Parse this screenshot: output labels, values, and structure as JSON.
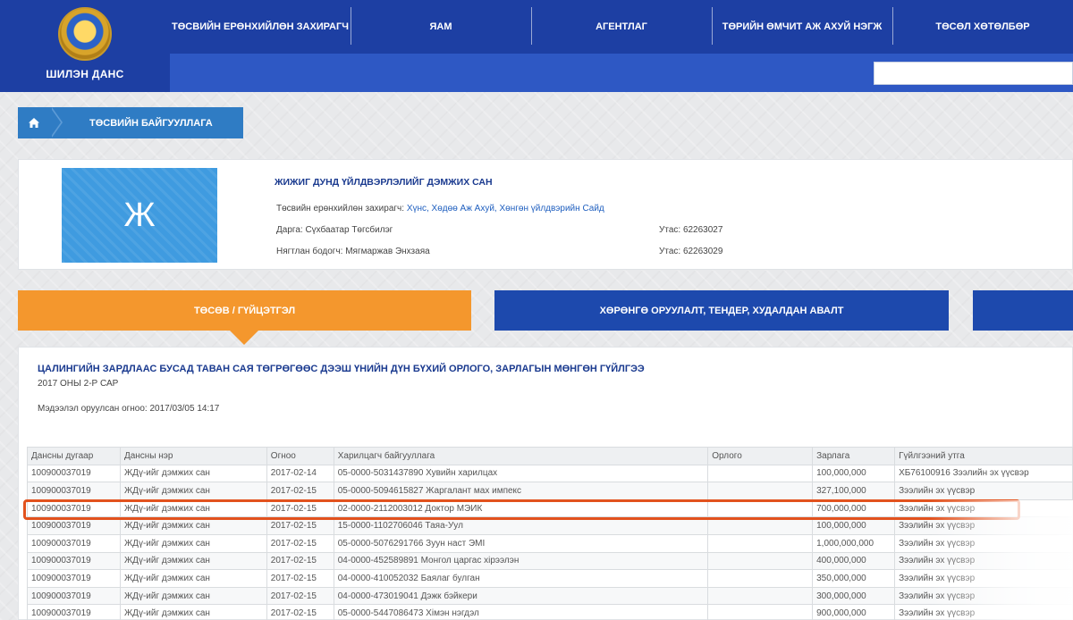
{
  "header": {
    "logo_text": "ШИЛЭН ДАНС",
    "nav": [
      "ТӨСВИЙН ЕРӨНХИЙЛӨН ЗАХИРАГЧ",
      "ЯАМ",
      "АГЕНТЛАГ",
      "ТӨРИЙН ӨМЧИТ АЖ АХУЙ НЭГЖ",
      "ТӨСӨЛ ХӨТӨЛБӨР"
    ],
    "search_placeholder": ""
  },
  "breadcrumb": {
    "home_icon": "home-icon",
    "item": "ТӨСВИЙН БАЙГУУЛЛАГА"
  },
  "org": {
    "logo_letter": "Ж",
    "title": "ЖИЖИГ ДУНД ҮЙЛДВЭРЛЭЛИЙГ ДЭМЖИХ САН",
    "manager_label": "Төсвийн ерөнхийлөн захирагч:",
    "manager_value": "Хүнс, Хөдөө Аж Ахуй, Хөнгөн үйлдвэрийн Сайд",
    "director": "Дарга: Сүхбаатар Төгсбилэг",
    "director_phone": "Утас: 62263027",
    "accountant": "Нягтлан бодогч: Мягмаржав Энхзаяа",
    "accountant_phone": "Утас: 62263029"
  },
  "tabs": {
    "active": "ТӨСӨВ / ГҮЙЦЭТГЭЛ",
    "second": "ХӨРӨНГӨ ОРУУЛАЛТ, ТЕНДЕР, ХУДАЛДАН АВАЛТ"
  },
  "report": {
    "title": "ЦАЛИНГИЙН ЗАРДЛААС БУСАД ТАВАН САЯ ТӨГРӨГӨӨС ДЭЭШ ҮНИЙН ДҮН БҮХИЙ ОРЛОГО, ЗАРЛАГЫН МӨНГӨН ГҮЙЛГЭЭ",
    "subtitle": "2017 ОНЫ 2-Р САР",
    "updated": "Мэдээлэл оруулсан огноо: 2017/03/05 14:17"
  },
  "table": {
    "headers": [
      "Дансны дугаар",
      "Дансны нэр",
      "Огноо",
      "Харилцагч байгууллага",
      "Орлого",
      "Зарлага",
      "Гүйлгээний утга"
    ],
    "rows": [
      [
        "100900037019",
        "ЖДү-ийг дэмжих сан",
        "2017-02-14",
        "05-0000-5031437890 Хувийн харилцах",
        "",
        "100,000,000",
        "ХБ76100916 Зээлийн эх үүсвэр"
      ],
      [
        "100900037019",
        "ЖДү-ийг дэмжих сан",
        "2017-02-15",
        "05-0000-5094615827 Жаргалант мах импекс",
        "",
        "327,100,000",
        "Зээлийн эх үүсвэр"
      ],
      [
        "100900037019",
        "ЖДү-ийг дэмжих сан",
        "2017-02-15",
        "02-0000-2112003012 Доктор МЭИК",
        "",
        "700,000,000",
        "Зээлийн эх үүсвэр"
      ],
      [
        "100900037019",
        "ЖДү-ийг дэмжих сан",
        "2017-02-15",
        "15-0000-1102706046 Таяа-Уул",
        "",
        "100,000,000",
        "Зээлийн эх үүсвэр"
      ],
      [
        "100900037019",
        "ЖДү-ийг дэмжих сан",
        "2017-02-15",
        "05-0000-5076291766 Зуун наст ЭМІ",
        "",
        "1,000,000,000",
        "Зээлийн эх үүсвэр"
      ],
      [
        "100900037019",
        "ЖДү-ийг дэмжих сан",
        "2017-02-15",
        "04-0000-452589891 Монгол царгас хірээлэн",
        "",
        "400,000,000",
        "Зээлийн эх үүсвэр"
      ],
      [
        "100900037019",
        "ЖДү-ийг дэмжих сан",
        "2017-02-15",
        "04-0000-410052032 Баялаг булган",
        "",
        "350,000,000",
        "Зээлийн эх үүсвэр"
      ],
      [
        "100900037019",
        "ЖДү-ийг дэмжих сан",
        "2017-02-15",
        "04-0000-473019041 Дэжк бэйкери",
        "",
        "300,000,000",
        "Зээлийн эх үүсвэр"
      ],
      [
        "100900037019",
        "ЖДү-ийг дэмжих сан",
        "2017-02-15",
        "05-0000-5447086473 Хімэн нэгдэл",
        "",
        "900,000,000",
        "Зээлийн эх үүсвэр"
      ]
    ]
  }
}
